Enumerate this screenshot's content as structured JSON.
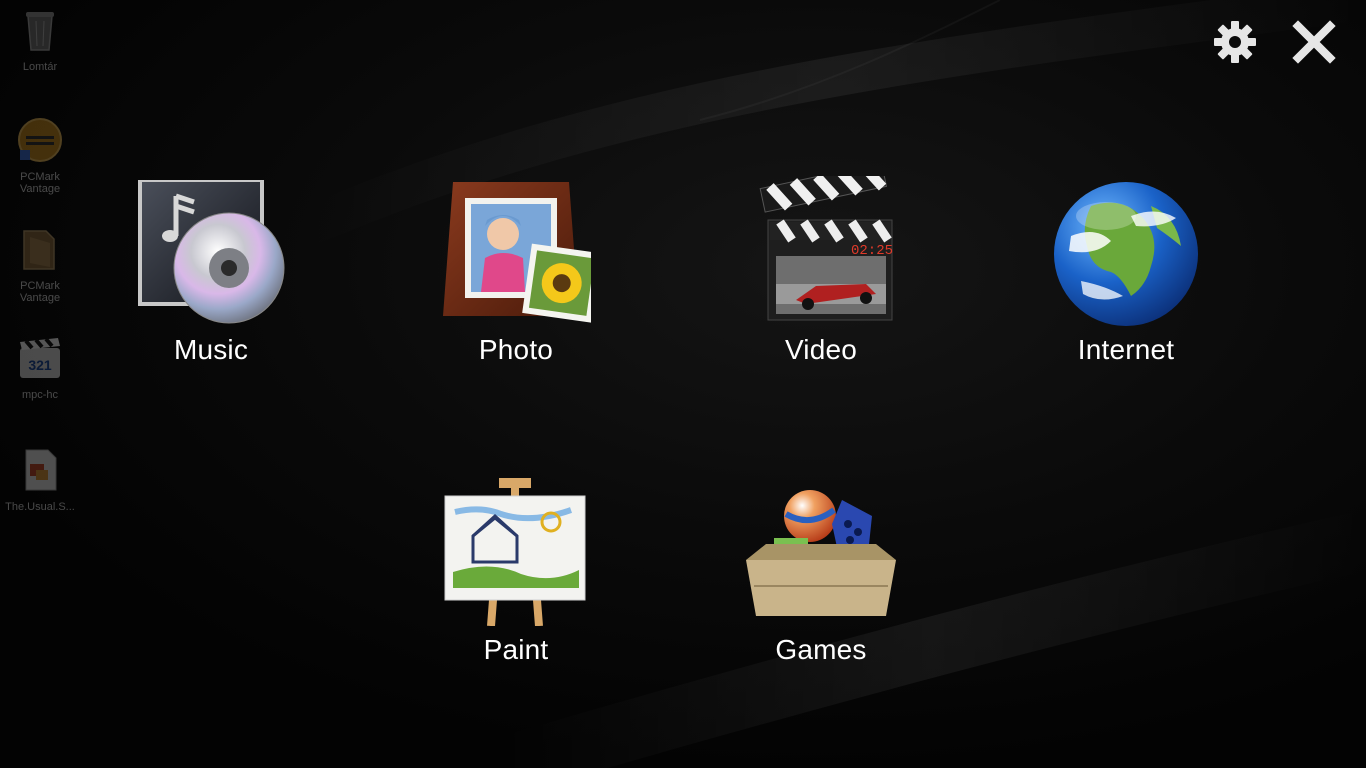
{
  "desktop": {
    "icons": [
      {
        "label": "Lomtár",
        "icon": "recycle-bin-icon"
      },
      {
        "label": "PCMark\nVantage",
        "icon": "pcmark-app-icon"
      },
      {
        "label": "PCMark\nVantage",
        "icon": "folder-icon"
      },
      {
        "label": "mpc-hc",
        "icon": "media-player-icon"
      },
      {
        "label": "The.Usual.S...",
        "icon": "document-icon"
      }
    ]
  },
  "controls": {
    "settings_icon": "gear-icon",
    "close_icon": "close-icon"
  },
  "launcher": {
    "tiles": [
      {
        "label": "Music",
        "icon": "music-cd-icon"
      },
      {
        "label": "Photo",
        "icon": "photo-frame-icon"
      },
      {
        "label": "Video",
        "icon": "clapperboard-icon"
      },
      {
        "label": "Internet",
        "icon": "globe-icon"
      },
      {
        "label": "Paint",
        "icon": "easel-icon"
      },
      {
        "label": "Games",
        "icon": "toy-box-icon"
      }
    ]
  },
  "colors": {
    "background": "#000000",
    "label_text": "#ffffff"
  }
}
